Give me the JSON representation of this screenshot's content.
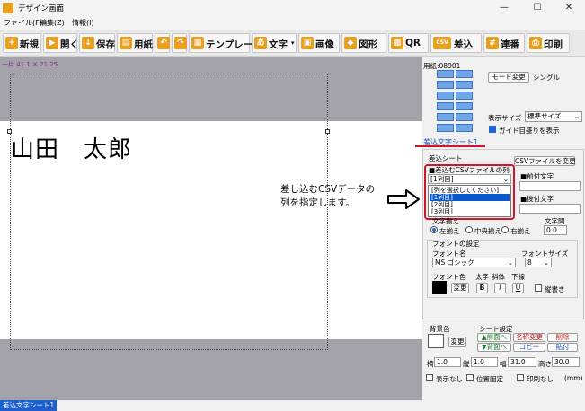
{
  "window": {
    "title": "デザイン画面",
    "minimize": "—",
    "maximize": "☐",
    "close": "✕"
  },
  "menu": [
    "ファイル(F)",
    "編集(Z)",
    "情報(I)"
  ],
  "toolbar": {
    "new": "新規",
    "open": "開く",
    "save": "保存",
    "paper": "用紙",
    "template": "テンプレート",
    "text": "文字",
    "text_prefix": "あ",
    "image": "画像",
    "shape": "図形",
    "qr": "QR",
    "merge": "差込",
    "merge_icon": "CSV",
    "serial": "連番",
    "print": "印刷"
  },
  "canvas": {
    "coords": "一片 41.1 ✕ 21.25",
    "name_text": "山田　太郎"
  },
  "annotation": {
    "text": "差し込むCSVデータの\n列を指定します。"
  },
  "panel": {
    "paper_no": "用紙:08901",
    "mode_btn": "モード変更",
    "mode_value": "シングル",
    "display_size_label": "表示サイズ",
    "display_size_value": "標準サイズ",
    "guide_label": "ガイド目盛りを表示",
    "sheet_tab": "差込文字シート1",
    "merge_sheet_label": "差込シート",
    "csv_change_btn": "CSVファイルを変更",
    "csv_column_label": "■差込むCSVファイルの列",
    "csv_column_value": "[1列目]",
    "dropdown_options": [
      "[列を選択してください]",
      "[1列目]",
      "[2列目]",
      "[3列目]"
    ],
    "dropdown_selected_index": 1,
    "prefix_label": "■前付文字",
    "suffix_label": "■後付文字",
    "align_label": "文字揃え",
    "align_left": "左揃え",
    "align_center": "中央揃え",
    "align_right": "右揃え",
    "spacing_label": "文字間",
    "spacing_value": "0.0",
    "font_settings_label": "フォントの設定",
    "font_name_label": "フォント名",
    "font_name_value": "MS ゴシック",
    "font_size_label": "フォントサイズ",
    "font_size_value": "8",
    "font_color_label": "フォント色",
    "change_btn": "変更",
    "bold_label": "太字",
    "italic_label": "斜体",
    "underline_label": "下線",
    "bold_btn": "B",
    "italic_btn": "I",
    "underline_btn": "U",
    "vertical_label": "縦書き",
    "bg_color_label": "背景色",
    "bg_change_btn": "変更",
    "sheet_settings_label": "シート設定",
    "front_btn": "▲前面へ",
    "back_btn": "▼背面へ",
    "rename_btn": "名称変更",
    "delete_btn": "削除",
    "copy_btn": "コピー",
    "paste_btn": "貼付",
    "x_label": "横",
    "x_value": "1.0",
    "y_label": "縦",
    "y_value": "1.0",
    "w_label": "幅",
    "w_value": "31.0",
    "h_label": "高さ",
    "h_value": "30.0",
    "hide_label": "表示なし",
    "lock_label": "位置固定",
    "noprint_label": "印刷なし",
    "unit_label": "(mm)"
  },
  "status": {
    "tab": "差込文字シート1"
  },
  "colors": {
    "accent": "#1e66d0",
    "highlight": "#d2152a",
    "canvas_bg": "#a4a3ab",
    "toolbar_icon": "#e8a020",
    "font_color_swatch": "#000000",
    "bg_color_swatch": "#ffffff"
  }
}
